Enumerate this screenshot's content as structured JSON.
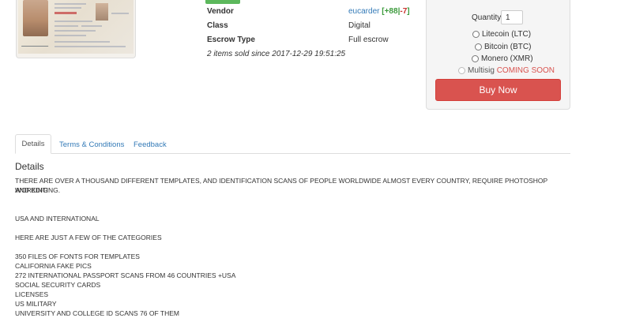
{
  "product": {
    "badge": "",
    "image_alt": "ID card template"
  },
  "info": {
    "vendor_label": "Vendor",
    "vendor_name": "eucarder",
    "vendor_feedback_open": "[",
    "vendor_feedback_pos": "+88",
    "vendor_feedback_sep": "|",
    "vendor_feedback_neg": "-7",
    "vendor_feedback_close": "]",
    "class_label": "Class",
    "class_value": "Digital",
    "escrow_label": "Escrow Type",
    "escrow_value": "Full escrow",
    "sold_note": "2 items sold since 2017-12-29 19:51:25"
  },
  "purchase": {
    "quantity_label": "Quantity:",
    "quantity_value": "1",
    "options": [
      "Litecoin (LTC)",
      "Bitcoin (BTC)",
      "Monero (XMR)"
    ],
    "multisig_label": "Multisig",
    "multisig_status": "COMING SOON",
    "buy_label": "Buy Now",
    "buy_color": "#d9534f"
  },
  "tabs": [
    "Details",
    "Terms & Conditions",
    "Feedback"
  ],
  "details": {
    "heading": "Details",
    "paragraph_1": "THERE ARE OVER A THOUSAND DIFFERENT TEMPLATES, AND IDENTIFICATION SCANS OF PEOPLE WORLDWIDE ALMOST EVERY COUNTRY, REQUIRE PHOTOSHOP WORKING",
    "paragraph_1b": "AND EDITING.",
    "line_usa": "USA AND INTERNATIONAL",
    "line_categories": "HERE ARE JUST A FEW OF THE CATEGORIES",
    "list": [
      "350 FILES OF FONTS FOR TEMPLATES",
      "CALIFORNIA FAKE PICS",
      "272 INTERNATIONAL PASSPORT SCANS FROM 46 COUNTRIES +USA",
      "SOCIAL SECURITY CARDS",
      "LICENSES",
      "US MILITARY",
      "UNIVERSITY AND COLLEGE ID SCANS 76 OF THEM"
    ]
  }
}
